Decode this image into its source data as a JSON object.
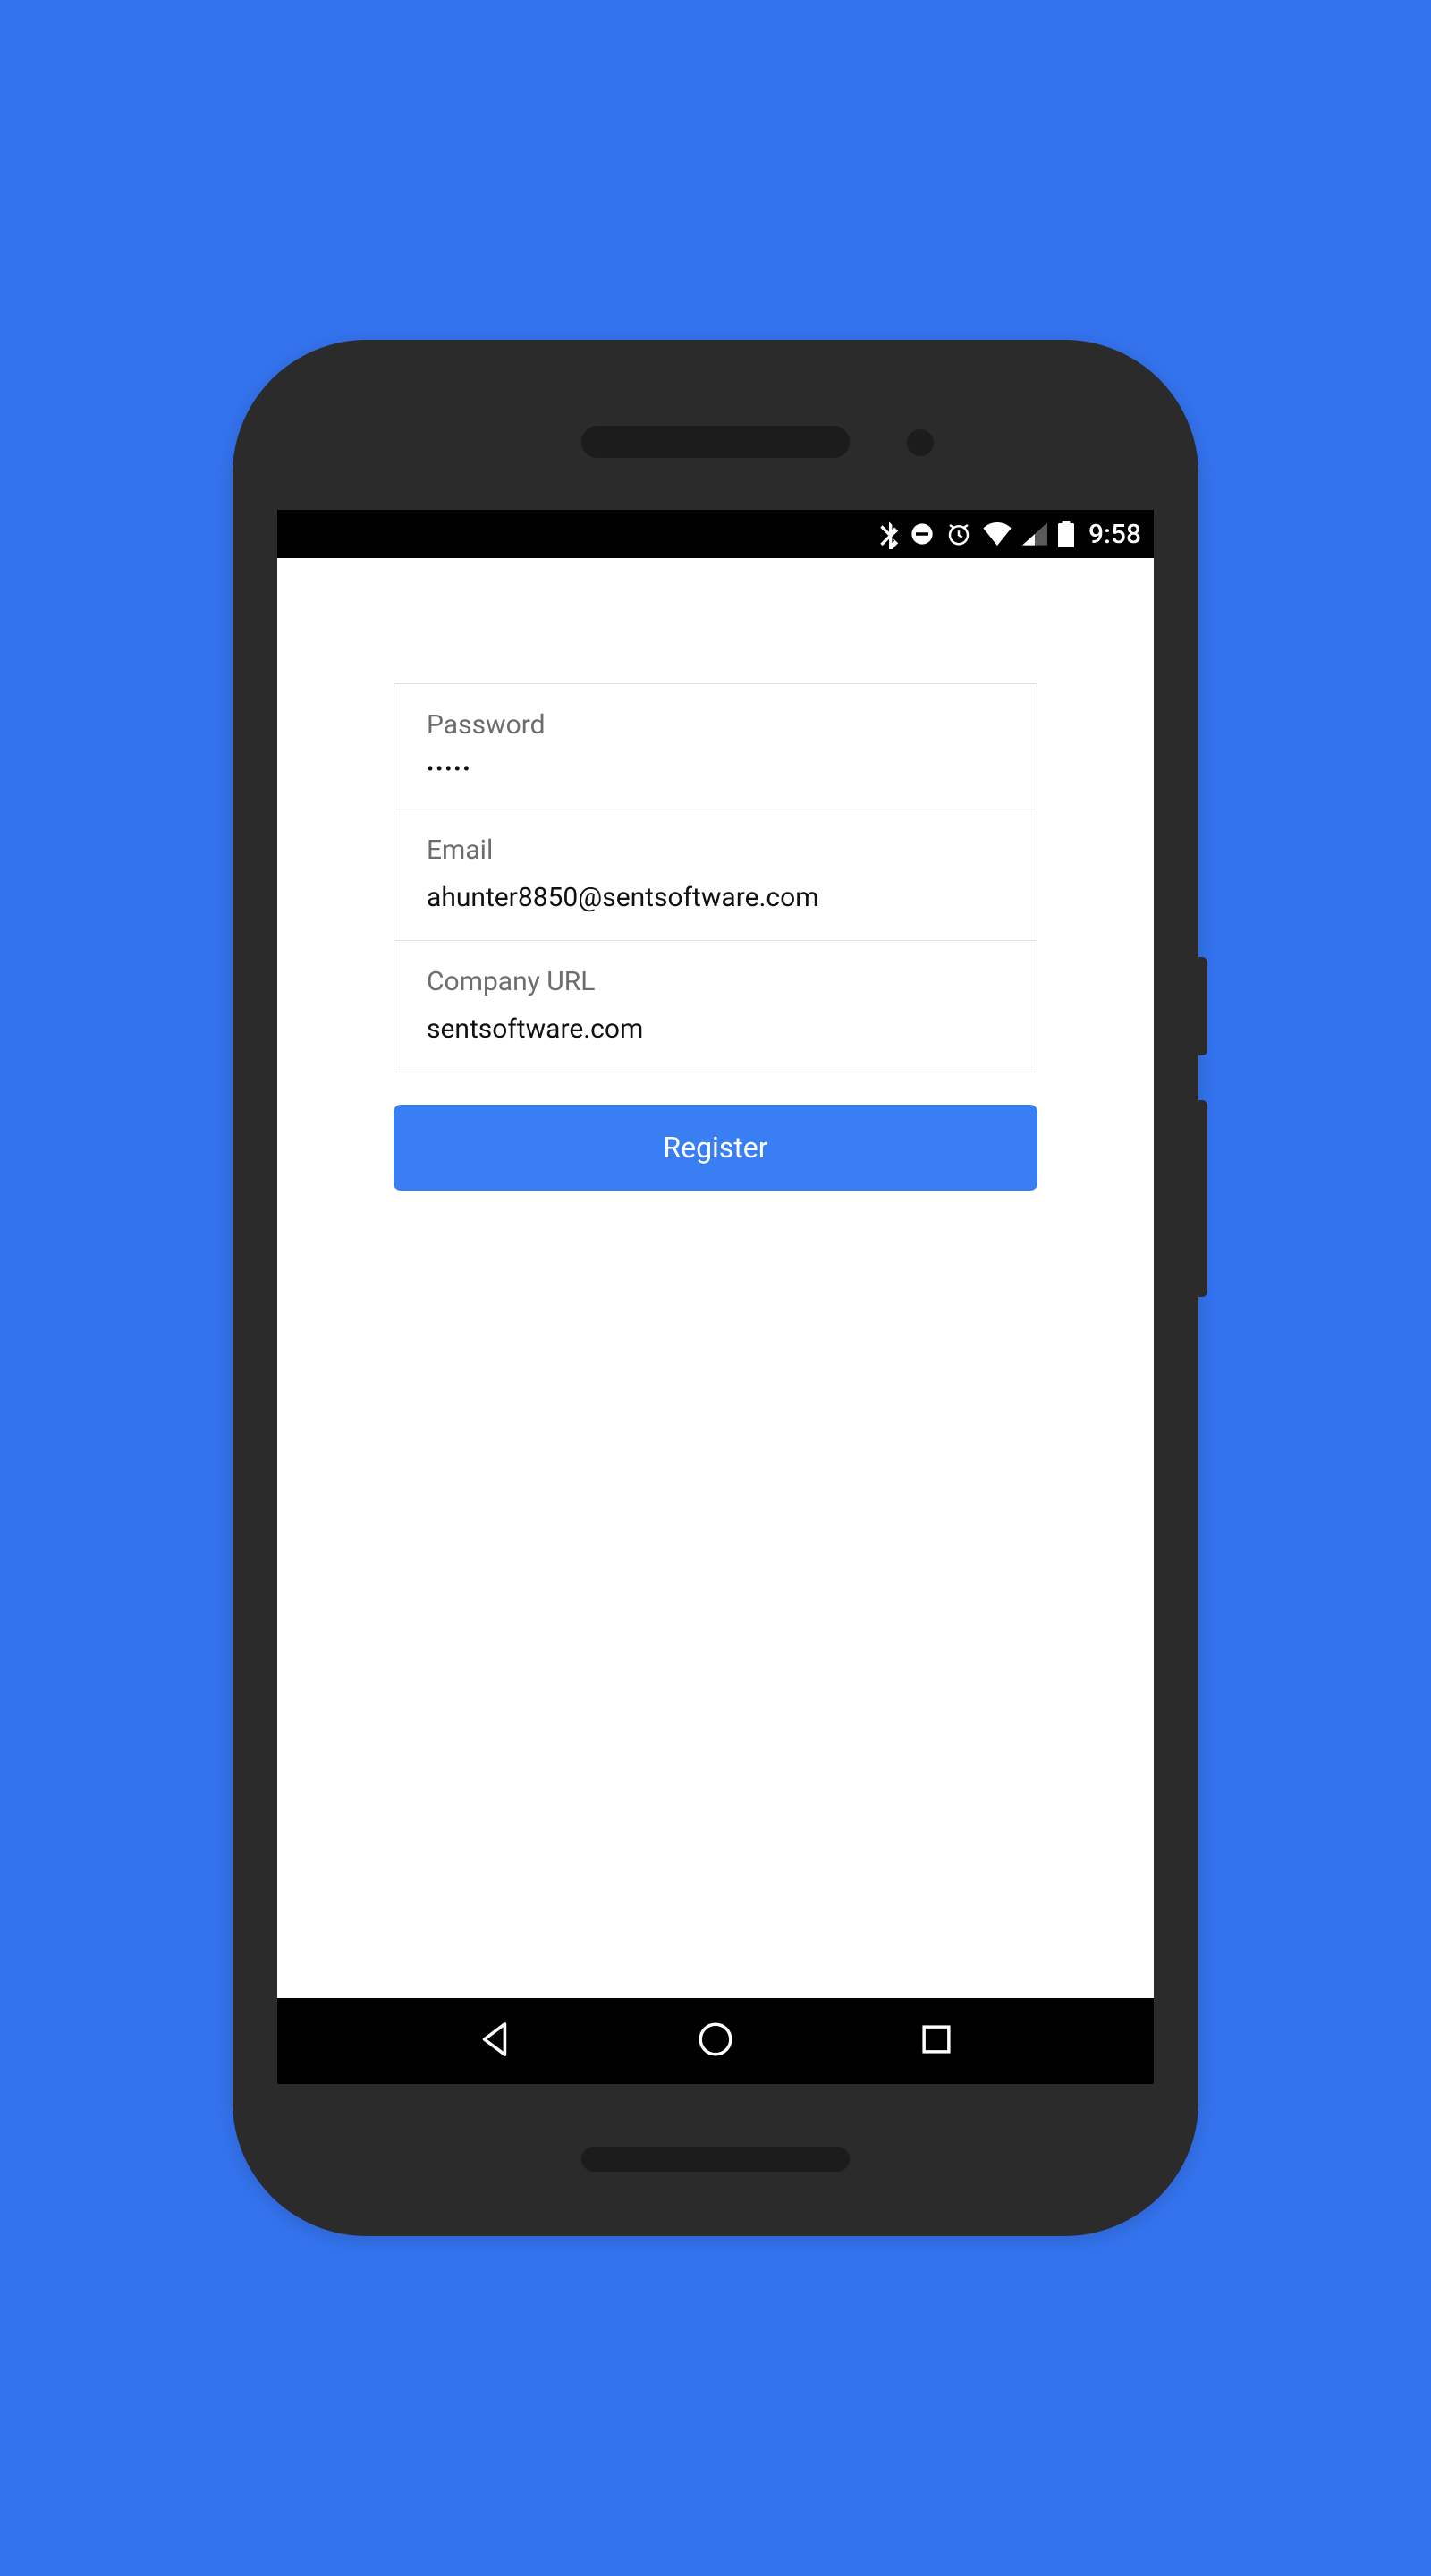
{
  "status": {
    "time": "9:58"
  },
  "form": {
    "password": {
      "label": "Password",
      "value": "•••••"
    },
    "email": {
      "label": "Email",
      "value": "ahunter8850@sentsoftware.com"
    },
    "company": {
      "label": "Company URL",
      "value": "sentsoftware.com"
    },
    "submit_label": "Register"
  },
  "colors": {
    "background": "#3473ee",
    "accent": "#397ff3"
  }
}
